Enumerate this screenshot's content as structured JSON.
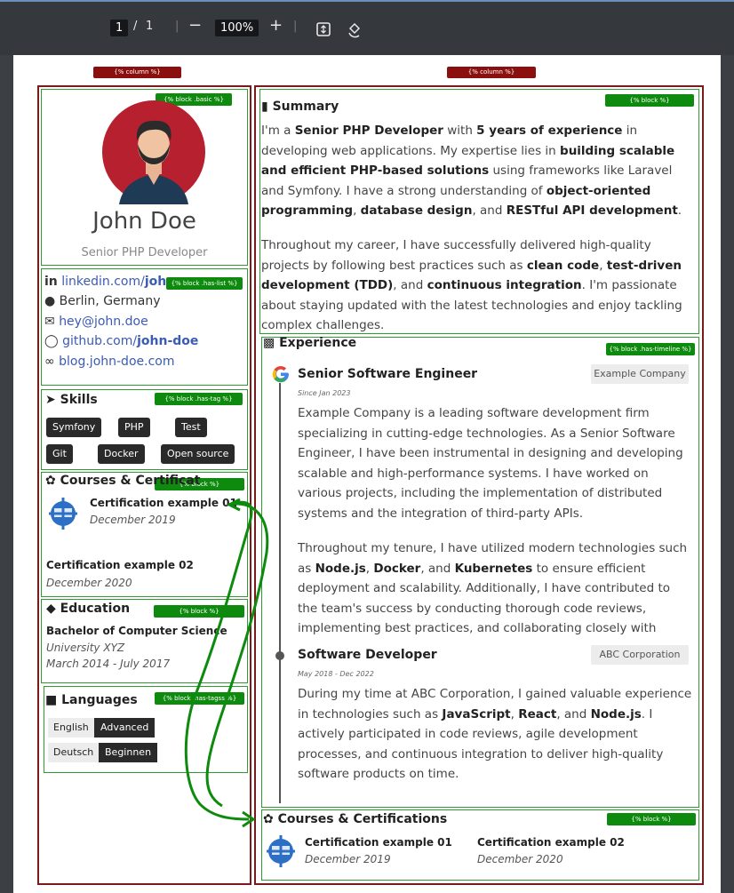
{
  "toolbar": {
    "page_current": "1",
    "page_sep": "/",
    "page_total": "1",
    "zoom": "100%"
  },
  "labels": {
    "column": "{% column %}",
    "block_basic": "{% block .basic %}",
    "block_has_list": "{% block .has-list %}",
    "block_has_tag": "{% block .has-tag %}",
    "block": "{% block %}",
    "block_has_tagss": "{% block .has-tagss %}",
    "block_has_timeline": "{% block .has-timeline %}"
  },
  "profile": {
    "name": "John Doe",
    "title": "Senior PHP Developer"
  },
  "contacts": {
    "linkedin_prefix": "linkedin.com/",
    "linkedin_bold": "joh",
    "location": "Berlin, Germany",
    "email": "hey@john.doe",
    "github_prefix": "github.com/",
    "github_bold": "john-doe",
    "blog": "blog.john-doe.com"
  },
  "skills": {
    "heading": "Skills",
    "tags": [
      "Symfony",
      "PHP",
      "Test",
      "Git",
      "Docker",
      "Open source"
    ]
  },
  "courses_left": {
    "heading": "Courses & Certificat",
    "items": [
      {
        "title": "Certification example 01",
        "date": "December 2019"
      },
      {
        "title": "Certification example 02",
        "date": "December 2020"
      }
    ]
  },
  "education": {
    "heading": "Education",
    "degree": "Bachelor of Computer Science",
    "school": "University XYZ",
    "dates": "March 2014 - July 2017"
  },
  "languages": {
    "heading": "Languages",
    "items": [
      {
        "lang": "English",
        "level": "Advanced"
      },
      {
        "lang": "Deutsch",
        "level": "Beginnen"
      }
    ]
  },
  "summary": {
    "heading": "Summary",
    "p1": [
      {
        "t": "I'm a ",
        "b": false
      },
      {
        "t": "Senior PHP Developer",
        "b": true
      },
      {
        "t": " with ",
        "b": false
      },
      {
        "t": "5 years of experience",
        "b": true
      },
      {
        "t": " in developing web applications. My expertise lies in ",
        "b": false
      },
      {
        "t": "building scalable and efficient PHP-based solutions",
        "b": true
      },
      {
        "t": " using frameworks like Laravel and Symfony. I have a strong understanding of ",
        "b": false
      },
      {
        "t": "object-oriented programming",
        "b": true
      },
      {
        "t": ", ",
        "b": false
      },
      {
        "t": "database design",
        "b": true
      },
      {
        "t": ", and ",
        "b": false
      },
      {
        "t": "RESTful API development",
        "b": true
      },
      {
        "t": ".",
        "b": false
      }
    ],
    "p2": [
      {
        "t": "Throughout my career, I have successfully delivered high-quality projects by following best practices such as ",
        "b": false
      },
      {
        "t": "clean code",
        "b": true
      },
      {
        "t": ", ",
        "b": false
      },
      {
        "t": "test-driven development (TDD)",
        "b": true
      },
      {
        "t": ", and ",
        "b": false
      },
      {
        "t": "continuous integration",
        "b": true
      },
      {
        "t": ". I'm passionate about staying updated with the latest technologies and enjoy tackling complex challenges.",
        "b": false
      }
    ]
  },
  "experience": {
    "heading": "Experience",
    "job1": {
      "title": "Senior Software Engineer",
      "company": "Example Company",
      "since": "Since Jan 2023",
      "p1": [
        {
          "t": "Example Company is a leading software development firm specializing in cutting-edge technologies. As a Senior Software Engineer, I have been instrumental in designing and developing scalable and high-performance systems. I have worked on various projects, including the implementation of distributed systems and the integration of third-party APIs.",
          "b": false
        }
      ],
      "p2": [
        {
          "t": "Throughout my tenure, I have utilized modern technologies such as ",
          "b": false
        },
        {
          "t": "Node.js",
          "b": true
        },
        {
          "t": ", ",
          "b": false
        },
        {
          "t": "Docker",
          "b": true
        },
        {
          "t": ", and ",
          "b": false
        },
        {
          "t": "Kubernetes",
          "b": true
        },
        {
          "t": " to ensure efficient deployment and scalability. Additionally, I have contributed to the team's success by conducting thorough code reviews, implementing best practices, and collaborating closely with cross-functional teams.",
          "b": false
        }
      ]
    },
    "job2": {
      "title": "Software Developer",
      "company": "ABC Corporation",
      "since": "May 2018 - Dec 2022",
      "p1": [
        {
          "t": "During my time at ABC Corporation, I gained valuable experience in technologies such as ",
          "b": false
        },
        {
          "t": "JavaScript",
          "b": true
        },
        {
          "t": ", ",
          "b": false
        },
        {
          "t": "React",
          "b": true
        },
        {
          "t": ", and ",
          "b": false
        },
        {
          "t": "Node.js",
          "b": true
        },
        {
          "t": ". I actively participated in code reviews, agile development processes, and continuous integration to deliver high-quality software products on time.",
          "b": false
        }
      ]
    }
  },
  "courses_right": {
    "heading": "Courses & Certifications",
    "items": [
      {
        "title": "Certification example 01",
        "date": "December 2019"
      },
      {
        "title": "Certification example 02",
        "date": "December 2020"
      }
    ]
  },
  "colors": {
    "accent_red": "#8b0f0f",
    "accent_green": "#0e8a0e",
    "avatar_bg": "#b7202e"
  }
}
